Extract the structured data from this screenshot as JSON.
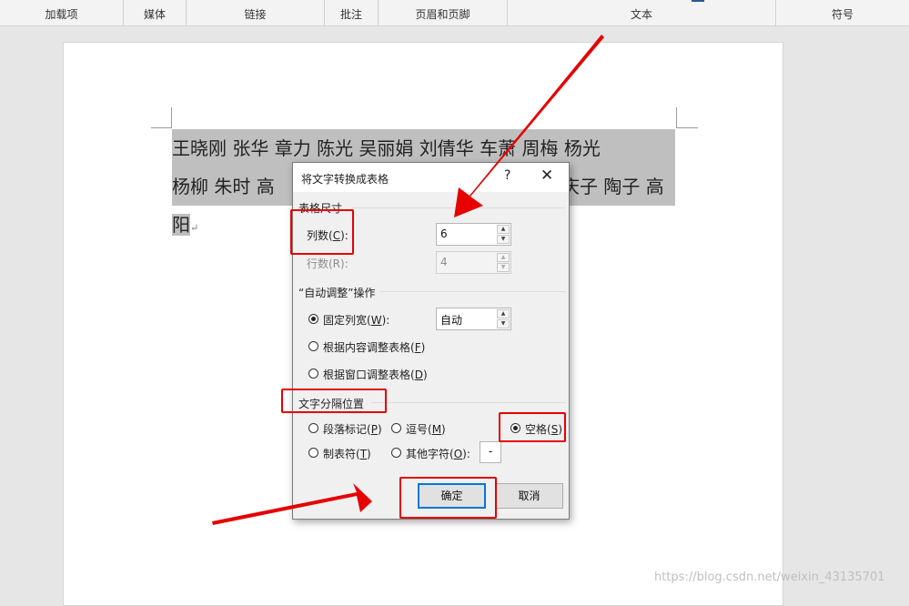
{
  "ribbon": {
    "groups": [
      "加载项",
      "媒体",
      "链接",
      "批注",
      "页眉和页脚",
      "文本",
      "符号"
    ]
  },
  "document": {
    "line1": "王晓刚 张华 章力 陈光 吴丽娟 刘倩华 车萧 周梅 杨光",
    "line2_left": "杨柳 朱时 高",
    "line2_right": "庆子 陶子 高",
    "line3": "阳",
    "para_mark": "↵"
  },
  "dialog": {
    "title": "将文字转换成表格",
    "help": "?",
    "close": "✕",
    "section_size": "表格尺寸",
    "cols_label": "列数(",
    "cols_key": "C",
    "cols_tail": "):",
    "cols_value": "6",
    "rows_label": "行数(R):",
    "rows_value": "4",
    "section_autofit": "“自动调整”操作",
    "fixed_label": "固定列宽(",
    "fixed_key": "W",
    "fixed_tail": "):",
    "fixed_value": "自动",
    "autofit_content": "根据内容调整表格(",
    "autofit_content_key": "F",
    "autofit_window": "根据窗口调整表格(",
    "autofit_window_key": "D",
    "close_paren": ")",
    "section_separator": "文字分隔位置",
    "sep_paragraph": "段落标记(",
    "sep_paragraph_key": "P",
    "sep_comma": "逗号(",
    "sep_comma_key": "M",
    "sep_space": "空格(",
    "sep_space_key": "S",
    "sep_tab": "制表符(",
    "sep_tab_key": "T",
    "sep_other": "其他字符(",
    "sep_other_key": "O",
    "sep_other_tail": "):",
    "sep_other_value": "-",
    "ok": "确定",
    "cancel": "取消"
  },
  "watermark": "https://blog.csdn.net/weixin_43135701",
  "colors": {
    "annotation_red": "#e60000",
    "selection": "#bfbfbf",
    "default_button_border": "#0078d7"
  }
}
